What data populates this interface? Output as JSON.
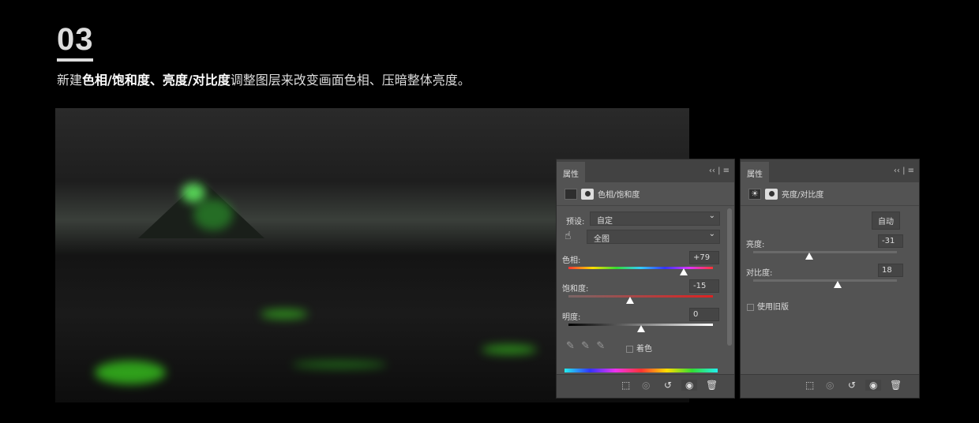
{
  "heading": {
    "step": "03",
    "caption_pre": "新建",
    "caption_bold": "色相/饱和度、亮度/对比度",
    "caption_post": "调整图层来改变画面色相、压暗整体亮度。"
  },
  "panel_hue": {
    "tab": "属性",
    "title": "色相/饱和度",
    "preset_label": "预设:",
    "preset_value": "自定",
    "range_value": "全图",
    "hue": {
      "label": "色相:",
      "value": "+79",
      "fraction": 0.8
    },
    "saturation": {
      "label": "饱和度:",
      "value": "-15",
      "fraction": 0.425
    },
    "lightness": {
      "label": "明度:",
      "value": "0",
      "fraction": 0.5
    },
    "colorize_label": "着色"
  },
  "panel_bc": {
    "tab": "属性",
    "title": "亮度/对比度",
    "auto_label": "自动",
    "brightness": {
      "label": "亮度:",
      "value": "-31",
      "fraction": 0.39
    },
    "contrast": {
      "label": "对比度:",
      "value": "18",
      "fraction": 0.59
    },
    "legacy_label": "使用旧版"
  },
  "colors": {
    "panel": "#535353",
    "accent_green": "#5aff2a"
  }
}
